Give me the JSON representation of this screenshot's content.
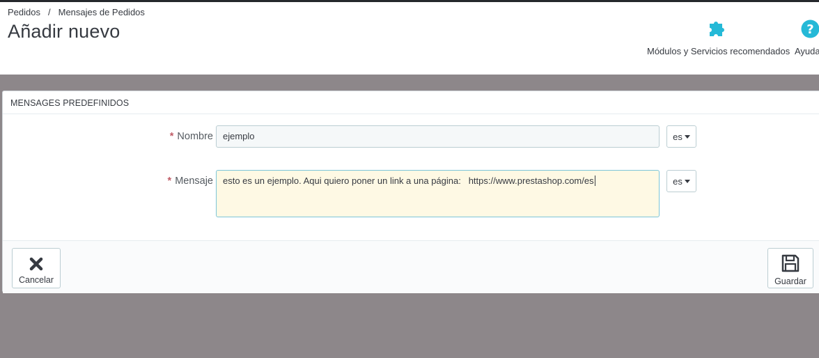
{
  "breadcrumb": {
    "item1": "Pedidos",
    "separator": "/",
    "item2": "Mensajes de Pedidos"
  },
  "header": {
    "title": "Añadir nuevo",
    "toolbar": {
      "modules_label": "Módulos y Servicios recomendados",
      "modules_icon": "puzzle-icon",
      "help_label": "Ayuda",
      "help_icon": "question-circle-icon"
    }
  },
  "panel": {
    "heading": "MENSAGES PREDEFINIDOS",
    "fields": {
      "name": {
        "required_mark": "*",
        "label": "Nombre",
        "value": "ejemplo",
        "lang": "es"
      },
      "message": {
        "required_mark": "*",
        "label": "Mensaje",
        "value": "esto es un ejemplo. Aqui quiero poner un link a una página:   https://www.prestashop.com/es",
        "lang": "es"
      }
    },
    "footer": {
      "cancel_label": "Cancelar",
      "cancel_icon": "close-icon",
      "save_label": "Guardar",
      "save_icon": "floppy-disk-icon"
    }
  },
  "colors": {
    "accent": "#25b9d7",
    "required": "#c05c67",
    "page_background": "#8d878a",
    "textarea_background": "#fef9e4"
  }
}
